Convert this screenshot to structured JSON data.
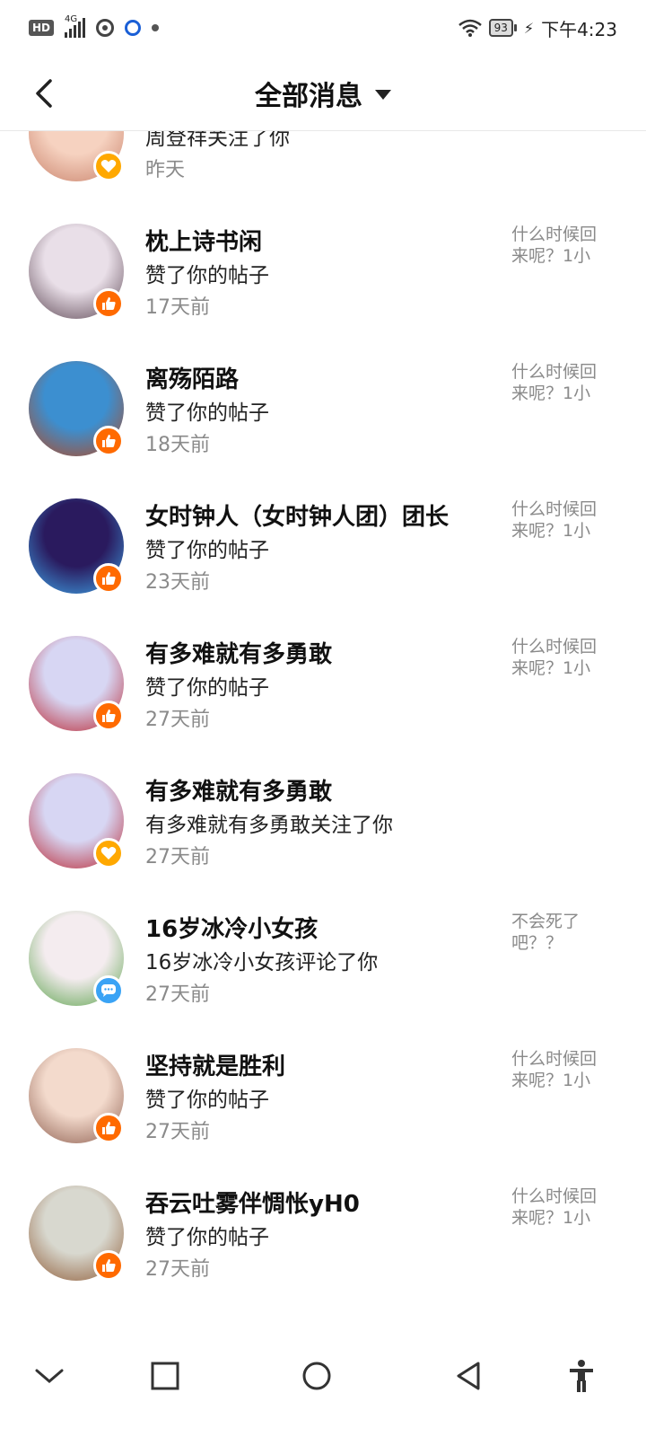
{
  "status_bar": {
    "hd": "HD",
    "network": "4G",
    "battery": "93",
    "time": "下午4:23"
  },
  "header": {
    "title": "全部消息"
  },
  "messages": [
    {
      "name": "",
      "action": "周登祥关注了你",
      "time": "昨天",
      "quote": "",
      "badge": "follow-icon",
      "colors": [
        "#f6d2c0",
        "#c9826b"
      ]
    },
    {
      "name": "枕上诗书闲",
      "action": "赞了你的帖子",
      "time": "17天前",
      "quote": "什么时候回来呢？1小",
      "badge": "like-icon",
      "colors": [
        "#e9dfe8",
        "#5b4552"
      ]
    },
    {
      "name": "离殇陌路",
      "action": "赞了你的帖子",
      "time": "18天前",
      "quote": "什么时候回来呢？1小",
      "badge": "like-icon",
      "colors": [
        "#3c8fd0",
        "#b3471e"
      ]
    },
    {
      "name": "女时钟人（女时钟人团）团长",
      "action": "赞了你的帖子",
      "time": "23天前",
      "quote": "什么时候回来呢？1小",
      "badge": "like-icon",
      "colors": [
        "#2a1a5e",
        "#3fa7ea"
      ]
    },
    {
      "name": "有多难就有多勇敢",
      "action": "赞了你的帖子",
      "time": "27天前",
      "quote": "什么时候回来呢？1小",
      "badge": "like-icon",
      "colors": [
        "#d7d6f3",
        "#b9232f"
      ]
    },
    {
      "name": "有多难就有多勇敢",
      "action": "有多难就有多勇敢关注了你",
      "time": "27天前",
      "quote": "",
      "badge": "follow-icon",
      "colors": [
        "#d7d6f3",
        "#b9232f"
      ]
    },
    {
      "name": "16岁冰冷小女孩",
      "action": "16岁冰冷小女孩评论了你",
      "time": "27天前",
      "quote": "不会死了吧？？",
      "badge": "comment-icon",
      "colors": [
        "#f4ecef",
        "#5aa24a"
      ]
    },
    {
      "name": "坚持就是胜利",
      "action": "赞了你的帖子",
      "time": "27天前",
      "quote": "什么时候回来呢？1小",
      "badge": "like-icon",
      "colors": [
        "#f3dacc",
        "#8c5c4d"
      ]
    },
    {
      "name": "吞云吐雾伴惆怅yH0",
      "action": "赞了你的帖子",
      "time": "27天前",
      "quote": "什么时候回来呢？1小",
      "badge": "like-icon",
      "colors": [
        "#d8d8cf",
        "#8e5a35"
      ]
    }
  ],
  "colors": {
    "like_badge": "#ff6a00",
    "follow_badge": "#ffa800",
    "comment_badge": "#3aa3f5",
    "secondary_text": "#8a8a8a"
  }
}
